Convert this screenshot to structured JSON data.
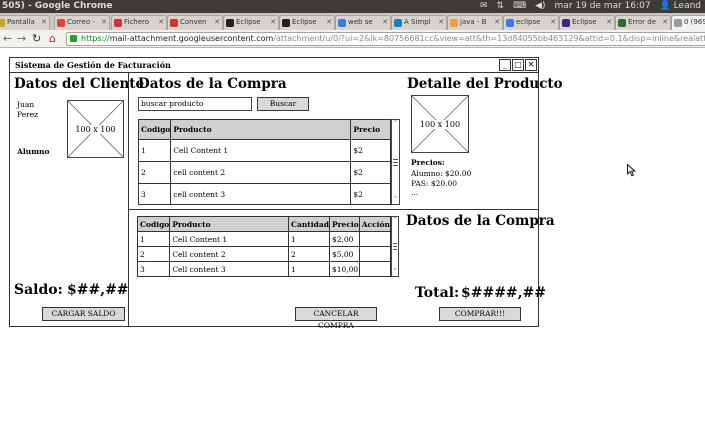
{
  "os_bar": {
    "window_title": "505) - Google Chrome",
    "clock": "mar 19 de mar 16:07",
    "user": "Leand"
  },
  "tabs": [
    {
      "label": "Pantalla",
      "color": "#c9a227"
    },
    {
      "label": "Correo -",
      "color": "#d44"
    },
    {
      "label": "Fichero",
      "color": "#c33"
    },
    {
      "label": "Conven",
      "color": "#c33"
    },
    {
      "label": "Eclipse",
      "color": "#222"
    },
    {
      "label": "Eclipse",
      "color": "#222"
    },
    {
      "label": "web se",
      "color": "#3b7be0"
    },
    {
      "label": "A Simpl",
      "color": "#1a7fc1"
    },
    {
      "label": "java - B",
      "color": "#e8a33a"
    },
    {
      "label": "eclipse",
      "color": "#3b7be0"
    },
    {
      "label": "Eclipse",
      "color": "#3a2c7a"
    },
    {
      "label": "Error de",
      "color": "#2d6b2d"
    },
    {
      "label": "0 (969-",
      "color": "#999"
    }
  ],
  "omnibox": {
    "scheme": "https://",
    "host": "mail-attachment.googleusercontent.com",
    "rest": "/attachment/u/0/?ui=2&ik=80756681cc&view=att&th=13d84055bb463129&attid=0.1&disp=inline&realattid=f_hehf"
  },
  "app": {
    "title": "Sistema de Gestión de Facturación",
    "client": {
      "heading": "Datos del Cliente",
      "name_line1": "Juan",
      "name_line2": "Perez",
      "photo_label": "100 x 100",
      "type": "Alumno",
      "balance_label": "Saldo:",
      "balance_value": "$##,##",
      "load_button": "CARGAR SALDO"
    },
    "purchase": {
      "heading": "Datos de la Compra",
      "search_value": "buscar producto",
      "search_button": "Buscar",
      "columns": [
        "Codigo",
        "Producto",
        "Precio"
      ],
      "rows": [
        [
          "1",
          "Cell Content 1",
          "$2"
        ],
        [
          "2",
          "cell content 2",
          "$2"
        ],
        [
          "3",
          "cell content 3",
          "$2"
        ]
      ]
    },
    "product_detail": {
      "heading": "Detalle del Producto",
      "image_label": "100 x 100",
      "prices_label": "Precios:",
      "price_alumno": "Alumno: $20.00",
      "price_pas": "PAS: $20.00",
      "ellipsis": "..."
    },
    "cart": {
      "columns": [
        "Codigo",
        "Producto",
        "Cantidad",
        "Precio",
        "Acción"
      ],
      "rows": [
        [
          "1",
          "Cell Content 1",
          "1",
          "$2,00",
          ""
        ],
        [
          "2",
          "Cell content 2",
          "2",
          "$5,00",
          ""
        ],
        [
          "3",
          "Cell content 3",
          "1",
          "$10,00",
          ""
        ]
      ],
      "cancel_button": "CANCELAR COMPRA"
    },
    "summary": {
      "heading": "Datos de la Compra",
      "total_label": "Total:",
      "total_value": "$####,##",
      "buy_button": "COMPRAR!!!"
    }
  }
}
